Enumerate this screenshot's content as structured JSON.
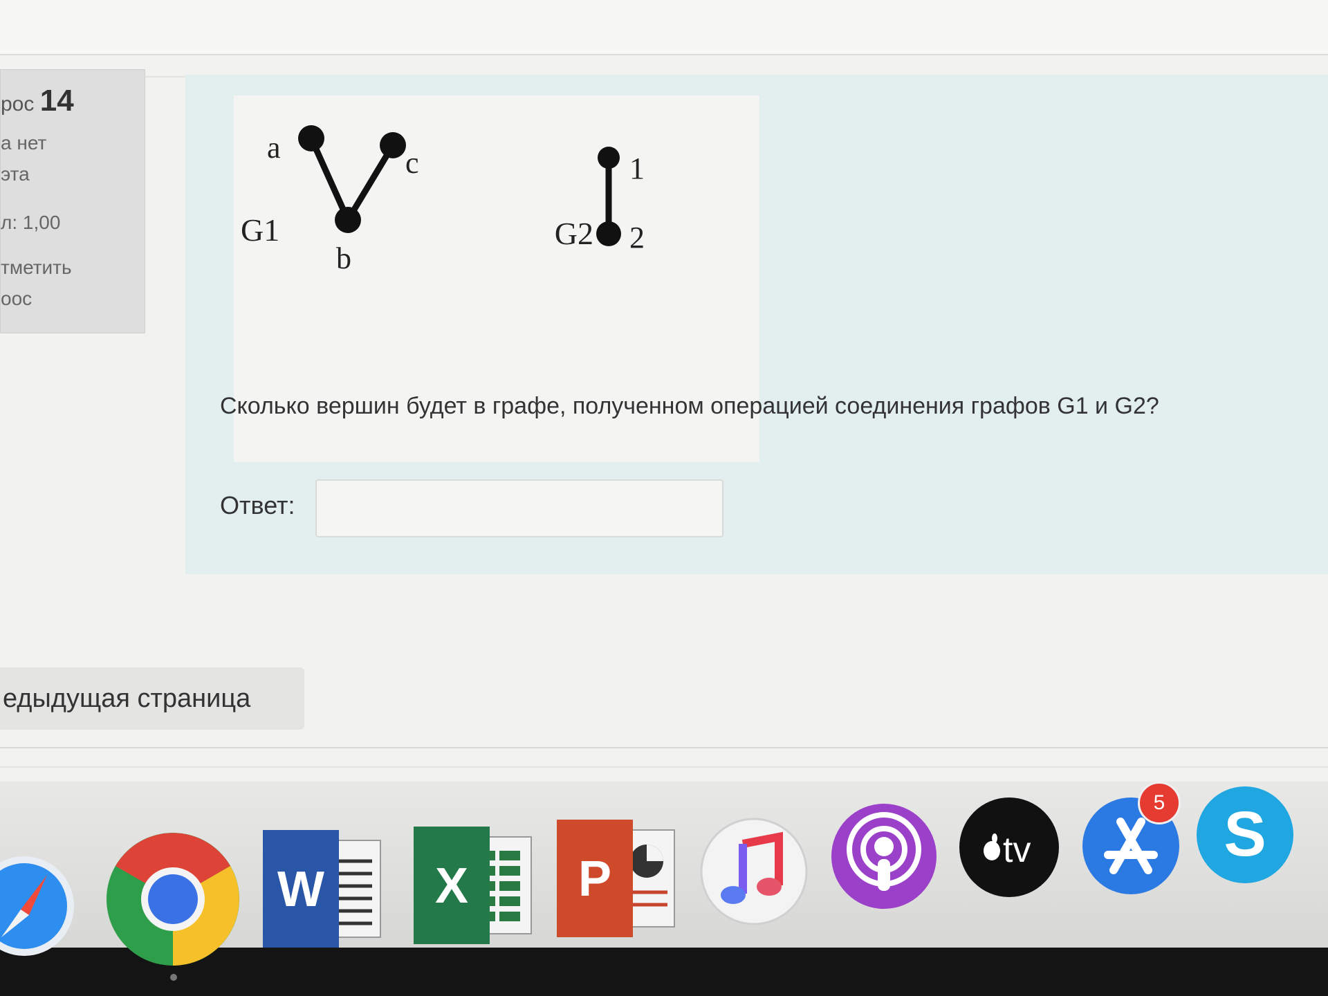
{
  "question_info": {
    "title_prefix": "рос",
    "number": "14",
    "status_line1": "а нет",
    "status_line2": "эта",
    "points": "л: 1,00",
    "flag_line1": "тметить",
    "flag_line2": "оос"
  },
  "figure": {
    "g1_label": "G1",
    "g1_vertices": [
      "a",
      "b",
      "c"
    ],
    "g2_label": "G2",
    "g2_vertices": [
      "1",
      "2"
    ]
  },
  "question": {
    "text": "Сколько вершин будет в графе, полученном операцией соединения графов G1 и G2?",
    "answer_label": "Ответ:",
    "answer_value": ""
  },
  "navigation": {
    "prev_label": "едыдущая страница"
  },
  "dock": {
    "icons": [
      "safari-icon",
      "chrome-icon",
      "word-icon",
      "excel-icon",
      "powerpoint-icon",
      "music-icon",
      "podcasts-icon",
      "apple-tv-icon",
      "app-store-icon",
      "skype-icon"
    ],
    "word_letter": "W",
    "excel_letter": "X",
    "powerpoint_letter": "P",
    "tv_label": "tv",
    "skype_letter": "S",
    "app_store_badge": "5"
  }
}
